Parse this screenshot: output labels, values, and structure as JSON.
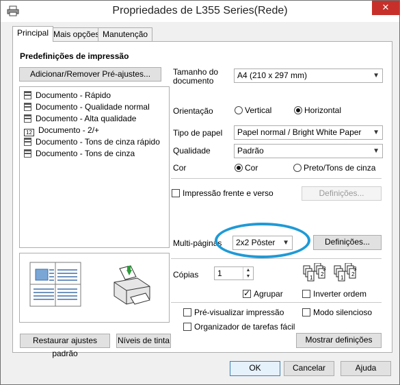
{
  "window": {
    "title": "Propriedades de L355 Series(Rede)",
    "close_glyph": "✕"
  },
  "tabs": [
    {
      "label": "Principal"
    },
    {
      "label": "Mais opções"
    },
    {
      "label": "Manutenção"
    }
  ],
  "presets": {
    "heading": "Predefinições de impressão",
    "add_remove_label": "Adicionar/Remover Pré-ajustes...",
    "items": [
      {
        "label": "Documento - Rápido",
        "icon": "document-icon"
      },
      {
        "label": "Documento - Qualidade normal",
        "icon": "document-icon"
      },
      {
        "label": "Documento - Alta qualidade",
        "icon": "document-icon"
      },
      {
        "label": "Documento - 2/+",
        "icon": "duplex-icon",
        "icon_text": "12"
      },
      {
        "label": "Documento - Tons de cinza rápido",
        "icon": "document-icon"
      },
      {
        "label": "Documento - Tons de cinza",
        "icon": "document-icon"
      }
    ]
  },
  "settings": {
    "paper_size_label": "Tamanho do documento",
    "paper_size_value": "A4 (210 x 297 mm)",
    "orientation_label": "Orientação",
    "orientation_vertical": "Vertical",
    "orientation_horizontal": "Horizontal",
    "paper_type_label": "Tipo de papel",
    "paper_type_value": "Papel normal / Bright White Paper",
    "quality_label": "Qualidade",
    "quality_value": "Padrão",
    "color_label": "Cor",
    "color_color": "Cor",
    "color_gray": "Preto/Tons de cinza",
    "duplex_label": "Impressão frente e verso",
    "duplex_settings_label": "Definições...",
    "multipage_label": "Multi-páginas",
    "multipage_value": "2x2 Pôster",
    "multipage_settings_label": "Definições...",
    "copies_label": "Cópias",
    "copies_value": "1",
    "collate_label": "Agrupar",
    "reverse_label": "Inverter ordem",
    "preview_label": "Pré-visualizar impressão",
    "quiet_label": "Modo silencioso",
    "job_arranger_label": "Organizador de tarefas fácil",
    "show_settings_label": "Mostrar definições",
    "restore_label": "Restaurar ajustes padrão",
    "ink_levels_label": "Níveis de tinta"
  },
  "dialog_buttons": {
    "ok": "OK",
    "cancel": "Cancelar",
    "help": "Ajuda"
  },
  "colors": {
    "highlight_oval": "#1f9ad6",
    "close_button": "#c7302a"
  }
}
